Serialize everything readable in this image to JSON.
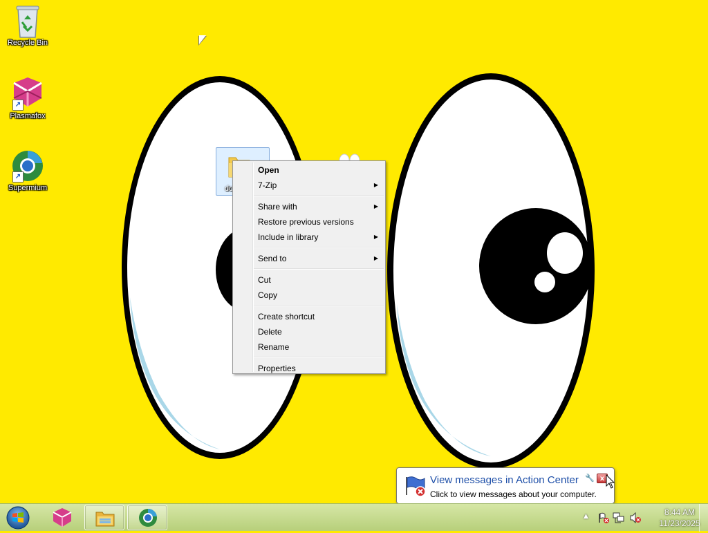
{
  "desktop": {
    "icons": [
      {
        "label": "Recycle Bin",
        "icon": "recycle-bin-icon"
      },
      {
        "label": "Plasmafox",
        "icon": "plasmafox-icon"
      },
      {
        "label": "Supermium",
        "icon": "supermium-icon"
      }
    ],
    "selected_item": {
      "label_visible": "do",
      "icon": "folder-icon"
    },
    "wallpaper": {
      "background": "#FFEA00",
      "description_colors": [
        "#FFEA00",
        "#000000",
        "#FFFFFF",
        "#A9D7E8"
      ]
    }
  },
  "context_menu": {
    "groups": [
      [
        {
          "label": "Open",
          "bold": true,
          "submenu": false
        },
        {
          "label": "7-Zip",
          "bold": false,
          "submenu": true
        }
      ],
      [
        {
          "label": "Share with",
          "bold": false,
          "submenu": true
        },
        {
          "label": "Restore previous versions",
          "bold": false,
          "submenu": false
        },
        {
          "label": "Include in library",
          "bold": false,
          "submenu": true
        }
      ],
      [
        {
          "label": "Send to",
          "bold": false,
          "submenu": true
        }
      ],
      [
        {
          "label": "Cut",
          "bold": false,
          "submenu": false
        },
        {
          "label": "Copy",
          "bold": false,
          "submenu": false
        }
      ],
      [
        {
          "label": "Create shortcut",
          "bold": false,
          "submenu": false
        },
        {
          "label": "Delete",
          "bold": false,
          "submenu": false
        },
        {
          "label": "Rename",
          "bold": false,
          "submenu": false
        }
      ],
      [
        {
          "label": "Properties",
          "bold": false,
          "submenu": false
        }
      ]
    ]
  },
  "notification": {
    "title": "View messages in Action Center",
    "text": "Click to view messages about your computer.",
    "close_label": "x",
    "icon": "action-center-flag-icon"
  },
  "taskbar": {
    "start_icon": "windows-start-orb-icon",
    "pinned": [
      {
        "name": "Plasmafox",
        "icon": "plasmafox-icon",
        "active": false
      },
      {
        "name": "Windows Explorer",
        "icon": "file-explorer-icon",
        "active": true
      },
      {
        "name": "Supermium",
        "icon": "supermium-icon",
        "active": true
      }
    ],
    "tray": {
      "show_hidden_icon": "▲",
      "icons": [
        "action-center-flag-icon",
        "network-icon",
        "volume-muted-icon"
      ],
      "time": "8:44 AM",
      "date": "11/23/2025"
    },
    "colors": {
      "top": "#d6e7a6",
      "bottom": "#b7cf7a"
    }
  }
}
